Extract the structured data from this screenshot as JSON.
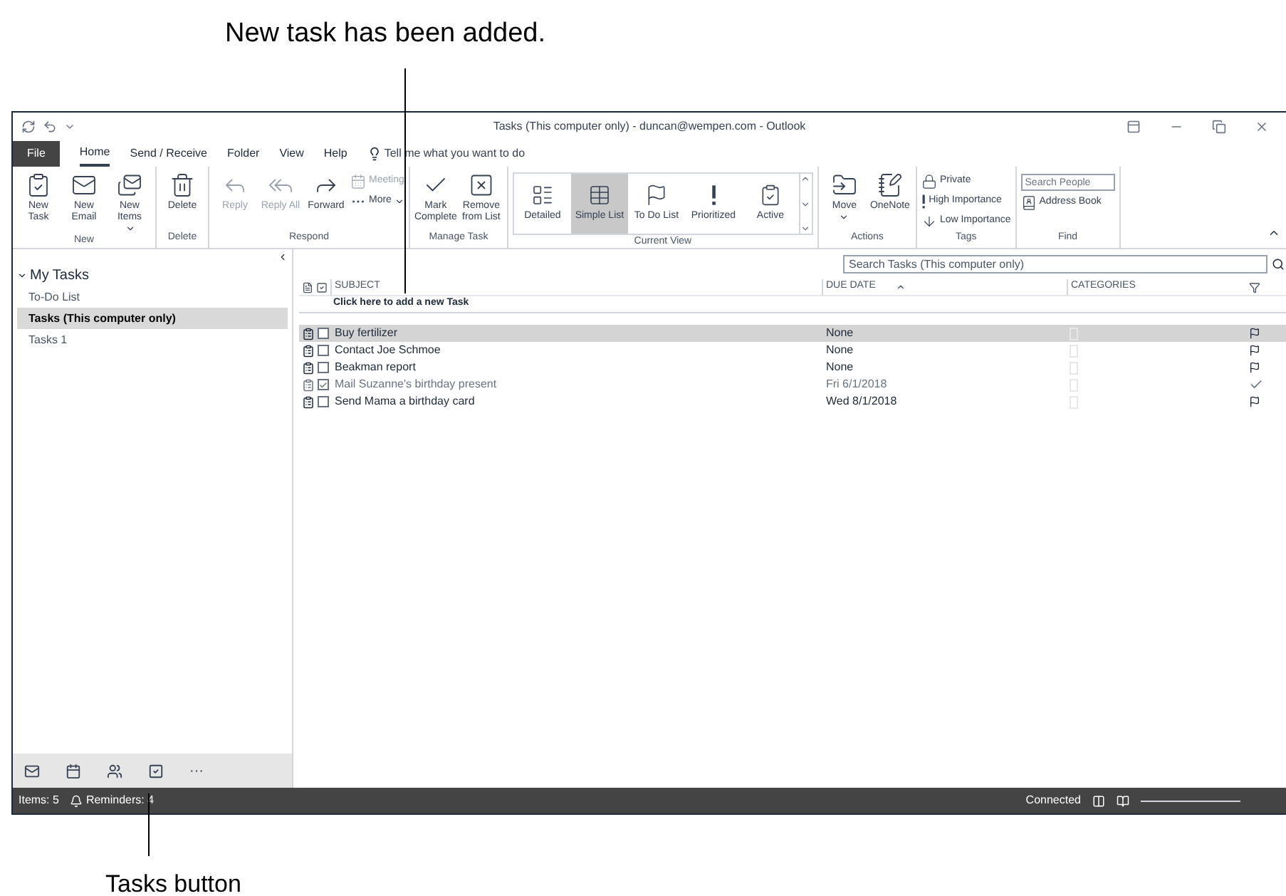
{
  "callouts": {
    "top": "New task has been added.",
    "bottom": "Tasks button"
  },
  "window": {
    "title": "Tasks (This computer only) - duncan@wempen.com  -  Outlook"
  },
  "ribbon_tabs": [
    {
      "label": "File",
      "selected": false,
      "kind": "file"
    },
    {
      "label": "Home",
      "selected": true,
      "kind": "tab"
    },
    {
      "label": "Send / Receive",
      "selected": false,
      "kind": "tab"
    },
    {
      "label": "Folder",
      "selected": false,
      "kind": "tab"
    },
    {
      "label": "View",
      "selected": false,
      "kind": "tab"
    },
    {
      "label": "Help",
      "selected": false,
      "kind": "tab"
    }
  ],
  "tell_me": "Tell me what you want to do",
  "ribbon_groups": [
    {
      "label": "New",
      "buttons": [
        {
          "label": "New Task",
          "kind": "large",
          "disabled": false,
          "dropdown": false
        },
        {
          "label": "New Email",
          "kind": "large",
          "disabled": false,
          "dropdown": false
        },
        {
          "label": "New Items",
          "kind": "large",
          "disabled": false,
          "dropdown": true
        }
      ]
    },
    {
      "label": "Delete",
      "buttons": [
        {
          "label": "Delete",
          "kind": "large",
          "disabled": false,
          "dropdown": false
        }
      ]
    },
    {
      "label": "Respond",
      "buttons": [
        {
          "label": "Reply",
          "kind": "large",
          "disabled": true,
          "dropdown": false
        },
        {
          "label": "Reply All",
          "kind": "large",
          "disabled": true,
          "dropdown": false
        },
        {
          "label": "Forward",
          "kind": "large",
          "disabled": false,
          "dropdown": false
        },
        {
          "label": "Meeting",
          "kind": "small",
          "disabled": true,
          "dropdown": false
        },
        {
          "label": "More",
          "kind": "small",
          "disabled": false,
          "dropdown": true
        }
      ]
    },
    {
      "label": "Manage Task",
      "buttons": [
        {
          "label": "Mark Complete",
          "kind": "large",
          "disabled": false,
          "dropdown": false
        },
        {
          "label": "Remove from List",
          "kind": "large",
          "disabled": false,
          "dropdown": false
        }
      ]
    },
    {
      "label": "Current View",
      "views": [
        {
          "label": "Detailed",
          "selected": false
        },
        {
          "label": "Simple List",
          "selected": true
        },
        {
          "label": "To Do List",
          "selected": false
        },
        {
          "label": "Prioritized",
          "selected": false
        },
        {
          "label": "Active",
          "selected": false
        }
      ]
    },
    {
      "label": "Actions",
      "buttons": [
        {
          "label": "Move",
          "kind": "large",
          "disabled": false,
          "dropdown": true
        },
        {
          "label": "OneNote",
          "kind": "large",
          "disabled": false,
          "dropdown": false
        }
      ]
    },
    {
      "label": "Tags",
      "buttons": [
        {
          "label": "Private",
          "kind": "small",
          "disabled": false,
          "dropdown": false
        },
        {
          "label": "High Importance",
          "kind": "small",
          "disabled": false,
          "dropdown": false
        },
        {
          "label": "Low Importance",
          "kind": "small",
          "disabled": false,
          "dropdown": false
        }
      ]
    },
    {
      "label": "Find",
      "search": {
        "placeholder": "Search People"
      },
      "buttons": [
        {
          "label": "Address Book",
          "kind": "small",
          "disabled": false,
          "dropdown": false
        }
      ]
    }
  ],
  "nav": {
    "header": "My Tasks",
    "expanded": true,
    "items": [
      {
        "label": "To-Do List",
        "selected": false
      },
      {
        "label": "Tasks (This computer only)",
        "selected": true
      },
      {
        "label": "Tasks 1",
        "selected": false
      }
    ],
    "more": "···"
  },
  "task_list": {
    "search": {
      "placeholder": "Search Tasks (This computer only)"
    },
    "columns": [
      "SUBJECT",
      "DUE DATE",
      "CATEGORIES"
    ],
    "new_task_prompt": "Click here to add a new Task",
    "rows": [
      {
        "subject": "Buy fertilizer",
        "due_date": "None",
        "complete": false,
        "selected": true
      },
      {
        "subject": "Contact Joe Schmoe",
        "due_date": "None",
        "complete": false,
        "selected": false
      },
      {
        "subject": "Beakman report",
        "due_date": "None",
        "complete": false,
        "selected": false
      },
      {
        "subject": "Mail Suzanne's birthday present",
        "due_date": "Fri 6/1/2018",
        "complete": true,
        "selected": false
      },
      {
        "subject": "Send Mama a birthday card",
        "due_date": "Wed 8/1/2018",
        "complete": false,
        "selected": false
      }
    ]
  },
  "status_bar": {
    "items": "Items: 5",
    "reminders": "Reminders: 4",
    "connection": "Connected"
  }
}
